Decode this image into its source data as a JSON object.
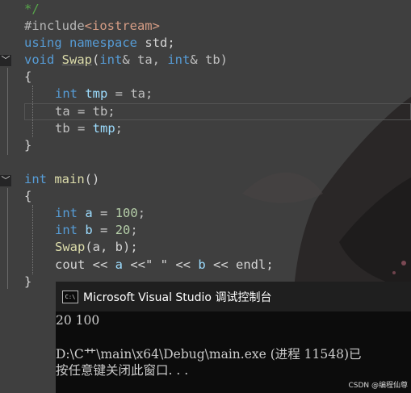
{
  "editor": {
    "lines": {
      "comment_end": "*/",
      "include_directive": "#include",
      "include_header": "<iostream>",
      "using_kw": "using",
      "namespace_kw": "namespace",
      "std_ns": "std;",
      "void_kw": "void",
      "swap_name": "Swap",
      "paren_open": "(",
      "int_kw": "int",
      "amp_ta": "& ta, ",
      "amp_tb": "& tb)",
      "brace_open": "{",
      "tmp_var": "tmp",
      "tmp_assign": " = ta;",
      "ta_assign": "ta = tb;",
      "tb_assign_lhs": "tb = ",
      "tmp_use": "tmp",
      "semicolon": ";",
      "brace_close": "}",
      "main_name": "main",
      "main_parens": "()",
      "a_var": "a",
      "a_assign": " = ",
      "a_value": "100",
      "b_var": "b",
      "b_assign": " = ",
      "b_value": "20",
      "swap_call": "Swap",
      "swap_args": "(a, b);",
      "cout_part": "cout << ",
      "cout_a": "a",
      "cout_mid": " <<\" \" << ",
      "cout_b": "b",
      "cout_end": " << endl;"
    }
  },
  "console": {
    "title": "Microsoft Visual Studio 调试控制台",
    "icon_text": "C:\\",
    "output": [
      "20 100",
      "",
      "D:\\C艹\\main\\x64\\Debug\\main.exe (进程 11548)已",
      "按任意键关闭此窗口. . ."
    ]
  },
  "watermark": "CSDN @编程仙尊",
  "colors": {
    "keyword": "#569cd6",
    "console_bg": "#0c0c0c",
    "titlebar_bg": "#1f1f1f"
  }
}
